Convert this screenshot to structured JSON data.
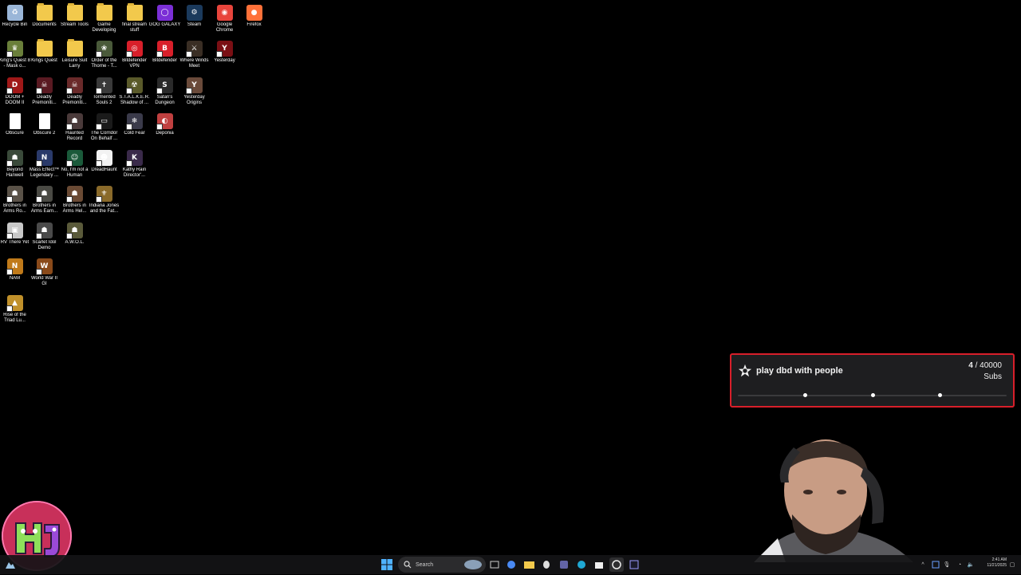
{
  "desktop": {
    "icons": [
      {
        "label": "Recycle Bin",
        "color": "#9ab6d8",
        "kind": "app",
        "glyph": "♻"
      },
      {
        "label": "Documents",
        "color": "#f2c94c",
        "kind": "folder",
        "glyph": ""
      },
      {
        "label": "Stream Tools",
        "color": "#f2c94c",
        "kind": "folder",
        "glyph": ""
      },
      {
        "label": "Game Developing",
        "color": "#f2c94c",
        "kind": "folder",
        "glyph": ""
      },
      {
        "label": "final stream stuff",
        "color": "#f2c94c",
        "kind": "folder",
        "glyph": ""
      },
      {
        "label": "GOG GALAXY",
        "color": "#7b2fd6",
        "kind": "app",
        "glyph": "◯"
      },
      {
        "label": "Steam",
        "color": "#1b3a5c",
        "kind": "app",
        "glyph": "⚙"
      },
      {
        "label": "Google Chrome",
        "color": "#e8453c",
        "kind": "app",
        "glyph": "◉"
      },
      {
        "label": "Firefox",
        "color": "#ff7139",
        "kind": "app",
        "glyph": "●"
      },
      {
        "label": "King's Quest 8 - Mask o...",
        "color": "#6a7f3a",
        "kind": "app",
        "glyph": "♛"
      },
      {
        "label": "Kings Quest",
        "color": "#f2c94c",
        "kind": "folder",
        "glyph": ""
      },
      {
        "label": "Leisure Suit Larry",
        "color": "#f2c94c",
        "kind": "folder",
        "glyph": ""
      },
      {
        "label": "Order of the Thorne - T...",
        "color": "#4a5a3a",
        "kind": "app",
        "glyph": "❀"
      },
      {
        "label": "Bitdefender VPN",
        "color": "#d81f2a",
        "kind": "app",
        "glyph": "◎"
      },
      {
        "label": "Bitdefender",
        "color": "#d81f2a",
        "kind": "app",
        "glyph": "B"
      },
      {
        "label": "Where Winds Meet",
        "color": "#3a2e24",
        "kind": "app",
        "glyph": "⚔"
      },
      {
        "label": "Yesterday",
        "color": "#7a0f14",
        "kind": "app",
        "glyph": "Y"
      },
      {
        "label": "DOOM + DOOM II",
        "color": "#a01818",
        "kind": "app",
        "glyph": "D"
      },
      {
        "label": "Deadly Premoniti...",
        "color": "#5a1a22",
        "kind": "app",
        "glyph": "☠"
      },
      {
        "label": "Deadly Premoniti...",
        "color": "#6a2a2a",
        "kind": "app",
        "glyph": "☠"
      },
      {
        "label": "Tormented Souls 2",
        "color": "#3a3a3a",
        "kind": "app",
        "glyph": "✝"
      },
      {
        "label": "S.T.A.L.K.E.R. Shadow of ...",
        "color": "#5a5a2a",
        "kind": "app",
        "glyph": "☢"
      },
      {
        "label": "Satan's Dungeon",
        "color": "#2a2a2a",
        "kind": "app",
        "glyph": "S"
      },
      {
        "label": "Yesterday Origins",
        "color": "#6a4a3a",
        "kind": "app",
        "glyph": "Y"
      },
      {
        "label": "Obscure",
        "color": "#ffffff",
        "kind": "file",
        "glyph": ""
      },
      {
        "label": "Obscure 2",
        "color": "#ffffff",
        "kind": "file",
        "glyph": ""
      },
      {
        "label": "Haunted Record",
        "color": "#4a3a3a",
        "kind": "app",
        "glyph": "☗"
      },
      {
        "label": "The Corridor On Behalf ...",
        "color": "#1a1a1a",
        "kind": "app",
        "glyph": "▭"
      },
      {
        "label": "Cold Fear",
        "color": "#3a3a4a",
        "kind": "app",
        "glyph": "❄"
      },
      {
        "label": "Deponia",
        "color": "#c04040",
        "kind": "app",
        "glyph": "◐"
      },
      {
        "label": "Beyond Hanwell",
        "color": "#3a4a3a",
        "kind": "app",
        "glyph": "☗"
      },
      {
        "label": "Mass Effect™ Legendary ...",
        "color": "#2a3a6a",
        "kind": "app",
        "glyph": "N"
      },
      {
        "label": "No, I'm not a Human",
        "color": "#1a5a3a",
        "kind": "app",
        "glyph": "☺"
      },
      {
        "label": "DreadHaunt",
        "color": "#f2f2f2",
        "kind": "app",
        "glyph": "☻"
      },
      {
        "label": "Kathy Rain Director'...",
        "color": "#3a2a4a",
        "kind": "app",
        "glyph": "K"
      },
      {
        "label": "Brothers in Arms Ro...",
        "color": "#5a5248",
        "kind": "app",
        "glyph": "☗"
      },
      {
        "label": "Brothers in Arms Earn...",
        "color": "#4a4a44",
        "kind": "app",
        "glyph": "☗"
      },
      {
        "label": "Brothers in Arms Hel...",
        "color": "#6a4a34",
        "kind": "app",
        "glyph": "☗"
      },
      {
        "label": "Indiana Jones and the Fat...",
        "color": "#8a6a2a",
        "kind": "app",
        "glyph": "⚜"
      },
      {
        "label": "RV There Yet",
        "color": "#c8c8c8",
        "kind": "app",
        "glyph": "▣"
      },
      {
        "label": "Scarlet Idol Demo",
        "color": "#4a4a4a",
        "kind": "app",
        "glyph": "☗"
      },
      {
        "label": "A.W.O.L.",
        "color": "#5a5a3a",
        "kind": "app",
        "glyph": "☗"
      },
      {
        "label": "NAM",
        "color": "#c07a1a",
        "kind": "app",
        "glyph": "N"
      },
      {
        "label": "World War II GI",
        "color": "#8a4a1a",
        "kind": "app",
        "glyph": "W"
      },
      {
        "label": "Rise of the Triad Lu...",
        "color": "#c0902a",
        "kind": "app",
        "glyph": "▲"
      }
    ]
  },
  "goal": {
    "title": "play dbd with people",
    "current": "4",
    "total": " / 40000",
    "unit": "Subs",
    "progress_fraction": 0.0001,
    "milestones": [
      0.25,
      0.5,
      0.75
    ]
  },
  "taskbar": {
    "search_placeholder": "Search",
    "time": "2:41 AM",
    "date": "11/21/2025"
  },
  "colors": {
    "accent": "#d81f2a",
    "widget_bg": "#1e1e20"
  }
}
